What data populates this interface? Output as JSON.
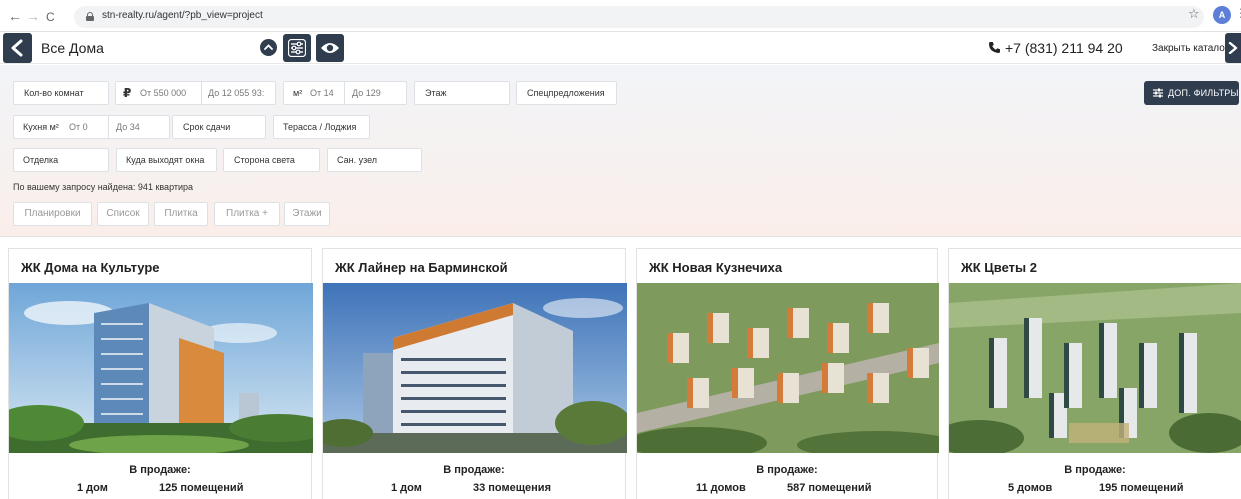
{
  "browser": {
    "url": "stn-realty.ru/agent/?pb_view=project",
    "back": "←",
    "forward": "→",
    "reload": "C",
    "star": "☆",
    "profile_initial": "A",
    "menu": "⋮"
  },
  "header": {
    "title": "Все Дома",
    "phone": "+7 (831) 211 94 20",
    "close_catalog": "Закрыть каталог"
  },
  "filters": {
    "rooms": "Кол-во комнат",
    "currency_symbol": "₽",
    "price_from": "От 550 000",
    "price_to": "До 12 055 93:",
    "area_unit": "м²",
    "area_from": "От 14",
    "area_to": "До 129",
    "floor": "Этаж",
    "special_offers": "Спецпредложения",
    "extra_filters": "ДОП. ФИЛЬТРЫ",
    "kitchen_label": "Кухня м²",
    "kitchen_from": "От 0",
    "kitchen_to": "До 34",
    "delivery_date": "Срок сдачи",
    "terrace": "Терасса / Лоджия",
    "finishing": "Отделка",
    "windows_view": "Куда выходят окна",
    "cardinal_side": "Сторона света",
    "bathroom": "Сан. узел"
  },
  "result_text": "По вашему запросу найдена: 941 квартира",
  "view_tabs": [
    "Планировки",
    "Список",
    "Плитка",
    "Плитка +",
    "Этажи"
  ],
  "cards": [
    {
      "title": "ЖК Дома на Культуре",
      "sale_label": "В продаже:",
      "houses": "1 дом",
      "rooms": "125 помещений"
    },
    {
      "title": "ЖК Лайнер на Барминской",
      "sale_label": "В продаже:",
      "houses": "1 дом",
      "rooms": "33 помещения"
    },
    {
      "title": "ЖК Новая Кузнечиха",
      "sale_label": "В продаже:",
      "houses": "11 домов",
      "rooms": "587 помещений"
    },
    {
      "title": "ЖК Цветы 2",
      "sale_label": "В продаже:",
      "houses": "5 домов",
      "rooms": "195 помещений"
    }
  ],
  "icons": {
    "back": "chevron-left-icon",
    "collapse": "chevron-up-icon",
    "filters": "sliders-icon",
    "view": "eye-icon",
    "phone": "phone-icon",
    "close": "chevron-right-icon",
    "lock": "lock-icon"
  },
  "colors": {
    "accent": "#2f3d4f"
  }
}
